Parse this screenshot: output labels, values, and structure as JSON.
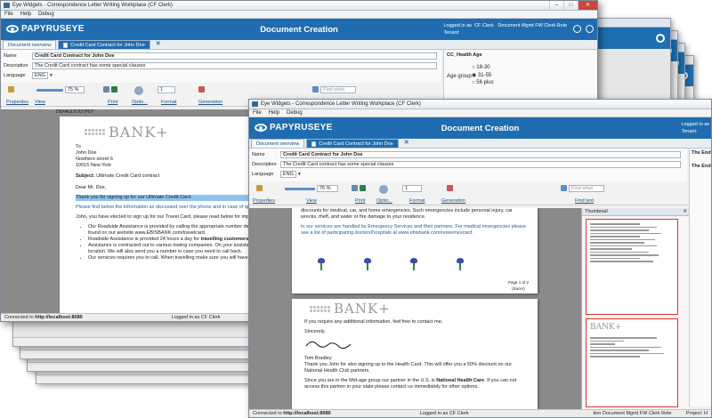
{
  "window_title": "Eye Widgets - Correspondence Letter Writing Workplace  (CF Clerk)",
  "menu": [
    "File",
    "Help",
    "Debug"
  ],
  "header": {
    "logo": "PAPYRUSEYE",
    "title": "Document Creation",
    "logged_in_label": "Logged in as",
    "user": "CF Clerk",
    "role": "Document Mgmt FW Clerk Role",
    "tenant": "Tenant:"
  },
  "tabs": {
    "overview": "Document overview",
    "active": "Credit Card Contract for John Doe"
  },
  "form": {
    "name_label": "Name",
    "name_value": "Credit Card Contract for John Doe",
    "desc_label": "Description",
    "desc_value": "The Credit Card contract has some special clauses",
    "lang_label": "Language",
    "lang_value": "ENG"
  },
  "toolbar": {
    "zoom": "75 %",
    "page": "1",
    "find_placeholder": "Find what",
    "groups": {
      "properties": "Properties",
      "view": "View",
      "print": "Print",
      "options": "Optio...",
      "format": "Format",
      "generation": "Generation",
      "findtext": "Find text"
    }
  },
  "age_panel": {
    "title": "CC_Health Age",
    "label": "Age group",
    "options": [
      "18-30",
      "31-55",
      "56 plus"
    ],
    "selected": "31-55"
  },
  "back_doc": {
    "default_output": "DEFAULTOUTPUT",
    "bank": "BANK+",
    "to": "To",
    "name": "John Doe",
    "street": "Nowhere street 6",
    "city": "10015 New York",
    "subject_label": "Subject:",
    "subject": "Ultimate Credit Card contract",
    "salutation": "Dear Mr. Doe,",
    "para1": "Thank you for signing up for our Ultimate Credit Card.",
    "para2": "Please find below the information as discussed over the phone and in case of question please do not hesitate to contact us.",
    "para3": "John, you have elected to sign up for our Travel Card, please read below for important information about this card:",
    "bullet1": "Our Roadside Assistance is provided by calling the appropriate number depending on your travel destination. This list can be found on our website www.EBISBANK.com/travelcard.",
    "bullet2a": "Roadside Assistance is provided 24 hours a day for ",
    "bullet2b": "travelling customers",
    "bullet3": "Assistance is contracted out to various towing companies. On your assistance call we will contact and send them to your location. We will also send you a number in case you need to call back.",
    "bullet4": "Our services requires you to call. When travelling make sure you will have"
  },
  "front_doc": {
    "p1": "discounts for medical, car, and home emergencies. Such emergencies include personal injury, car wrecks, theft, and water or fire damage to your residence.",
    "p2": "In our services are handled by Emergency Services and their partners. For medical emergencies please see a list of participating doctors/hospitals at www.ebisbank.com/nowemescard.",
    "page_label": "Page 1 of 2",
    "page_sub": "(tracer)",
    "bank": "BANK+",
    "more_info": "If you require any additional information, feel free to contact me.",
    "sincerely": "Sincerely,",
    "signer": "Tom Bradley",
    "p3": "Thank you John for also signing up to the Health Card. This will offer you a 50% discount on our National Health Club partners.",
    "p4a": "Since you are in the Mid-age group our partner in the U.S. is ",
    "p4b": "National Health Care",
    "p4c": ". If you can not access this partner in your state please contact us immediately for other options."
  },
  "thumbnail": {
    "title": "Thumbnail"
  },
  "right_panel": {
    "line1": "The End",
    "line2": "The End"
  },
  "status": {
    "connected_label": "Connected to",
    "connected_url": "http://localhost:8080",
    "logged_in": "Logged in as CF Clerk",
    "role_short": "tion  Document Mgmt FW Clerk Role",
    "project": "Project: H"
  },
  "colors": {
    "brand_blue": "#1f6db0",
    "highlight": "#8fc3ef"
  }
}
